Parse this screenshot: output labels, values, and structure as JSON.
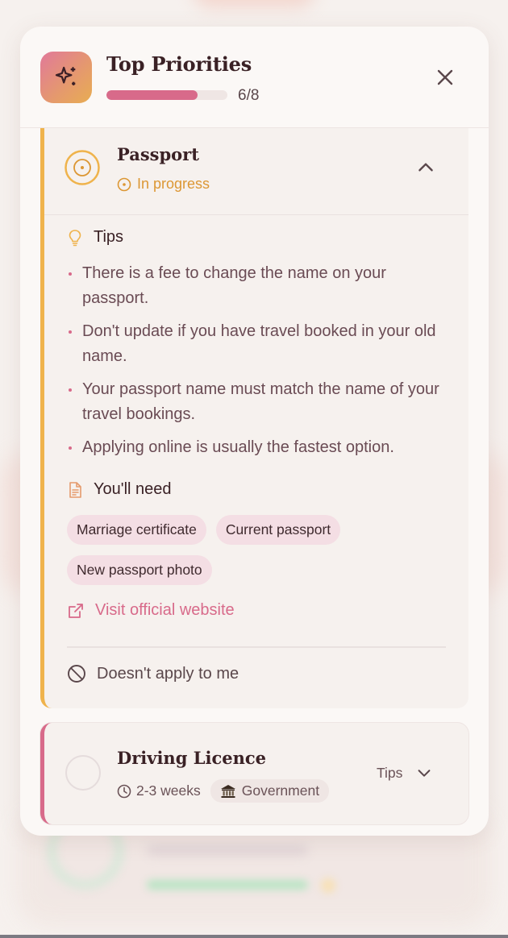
{
  "header": {
    "title": "Top Priorities",
    "progress_text": "6/8",
    "progress_fraction": 0.75
  },
  "passport": {
    "title": "Passport",
    "status": "In progress",
    "tips_label": "Tips",
    "tips": [
      "There is a fee to change the name on your passport.",
      "Don't update if you have travel booked in your old name.",
      "Your passport name must match the name of your travel bookings.",
      "Applying online is usually the fastest option."
    ],
    "need_label": "You'll need",
    "documents": [
      "Marriage certificate",
      "Current passport",
      "New passport photo"
    ],
    "visit_link": "Visit official website",
    "not_apply": "Doesn't apply to me"
  },
  "driving": {
    "title": "Driving Licence",
    "duration": "2-3 weeks",
    "source": "Government",
    "tips_label": "Tips"
  },
  "colors": {
    "accent_pink": "#d86a8a",
    "accent_orange": "#efb34c",
    "title": "#3a2125",
    "background": "#f6f1ee"
  },
  "icons": {
    "app": "sparkles-icon",
    "close": "close-icon",
    "status": "target-icon",
    "tips": "lightbulb-icon",
    "need": "document-icon",
    "visit": "external-link-icon",
    "not_apply": "ban-icon",
    "duration": "clock-icon",
    "source": "bank-icon"
  }
}
